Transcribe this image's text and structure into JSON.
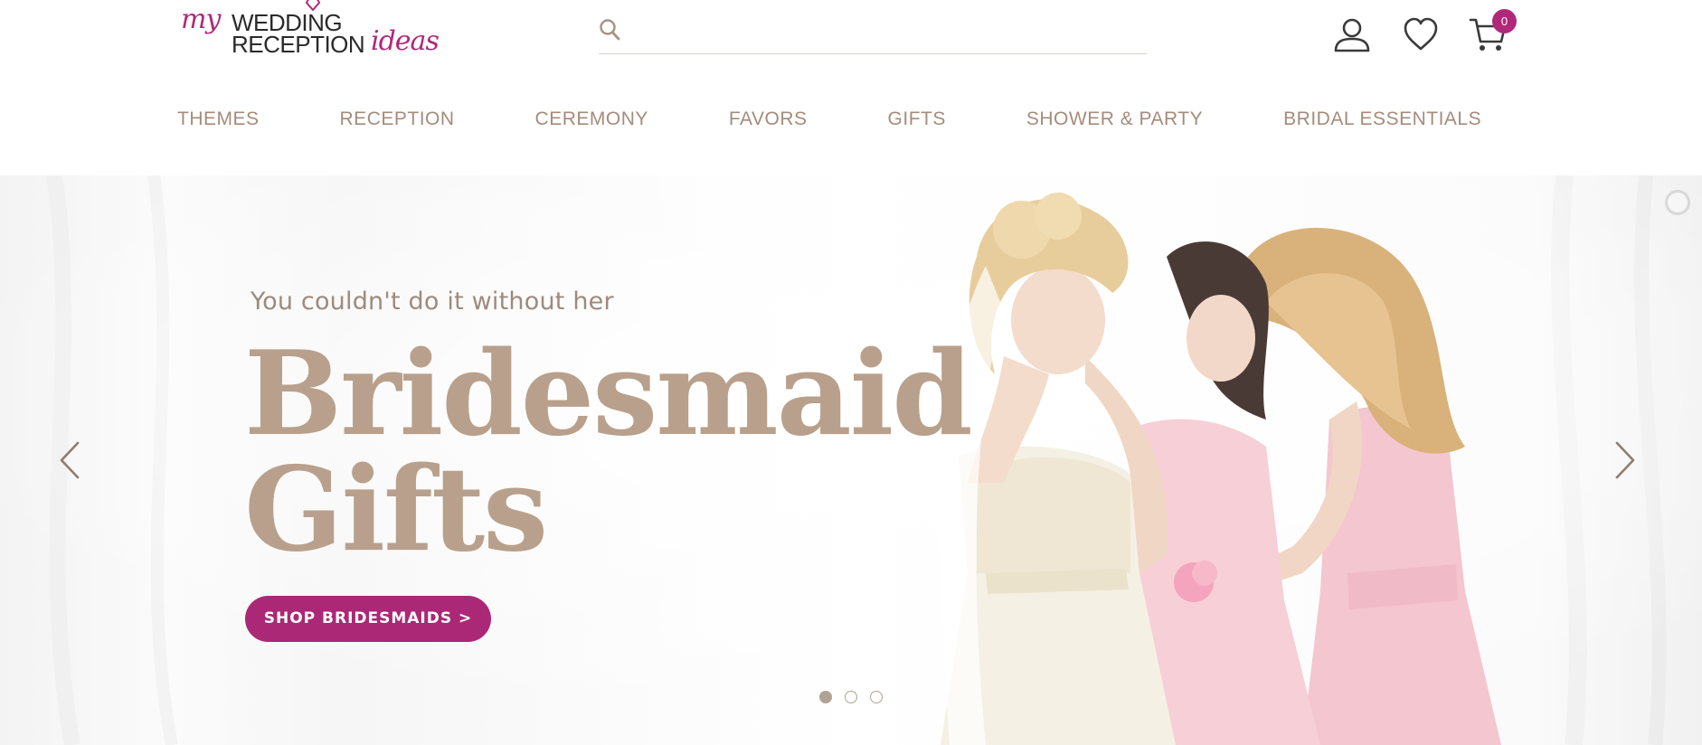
{
  "header": {
    "logo": {
      "my": "my",
      "wedding": "WEDDING",
      "reception": "RECEPTION",
      "ideas": "ideas",
      "brand_color": "#b0287a"
    },
    "search": {
      "placeholder": "",
      "value": "",
      "icon": "search-icon"
    },
    "icons": {
      "account": "user-icon",
      "wishlist": "heart-icon",
      "cart": "cart-icon"
    },
    "cart_count": "0"
  },
  "nav": {
    "items": [
      {
        "label": "THEMES"
      },
      {
        "label": "RECEPTION"
      },
      {
        "label": "CEREMONY"
      },
      {
        "label": "FAVORS"
      },
      {
        "label": "GIFTS"
      },
      {
        "label": "SHOWER & PARTY"
      },
      {
        "label": "BRIDAL ESSENTIALS"
      }
    ],
    "color": "#a48c7c"
  },
  "hero": {
    "tagline": "You couldn't do it without her",
    "headline_line1": "Bridesmaid",
    "headline_line2": "Gifts",
    "cta_label": "SHOP BRIDESMAIDS >",
    "cta_color": "#ab2877",
    "headline_color": "#b8a08c",
    "slides": 3,
    "active_slide": 1,
    "icons": {
      "prev": "chevron-left-icon",
      "next": "chevron-right-icon",
      "pause": "pause-icon"
    }
  }
}
